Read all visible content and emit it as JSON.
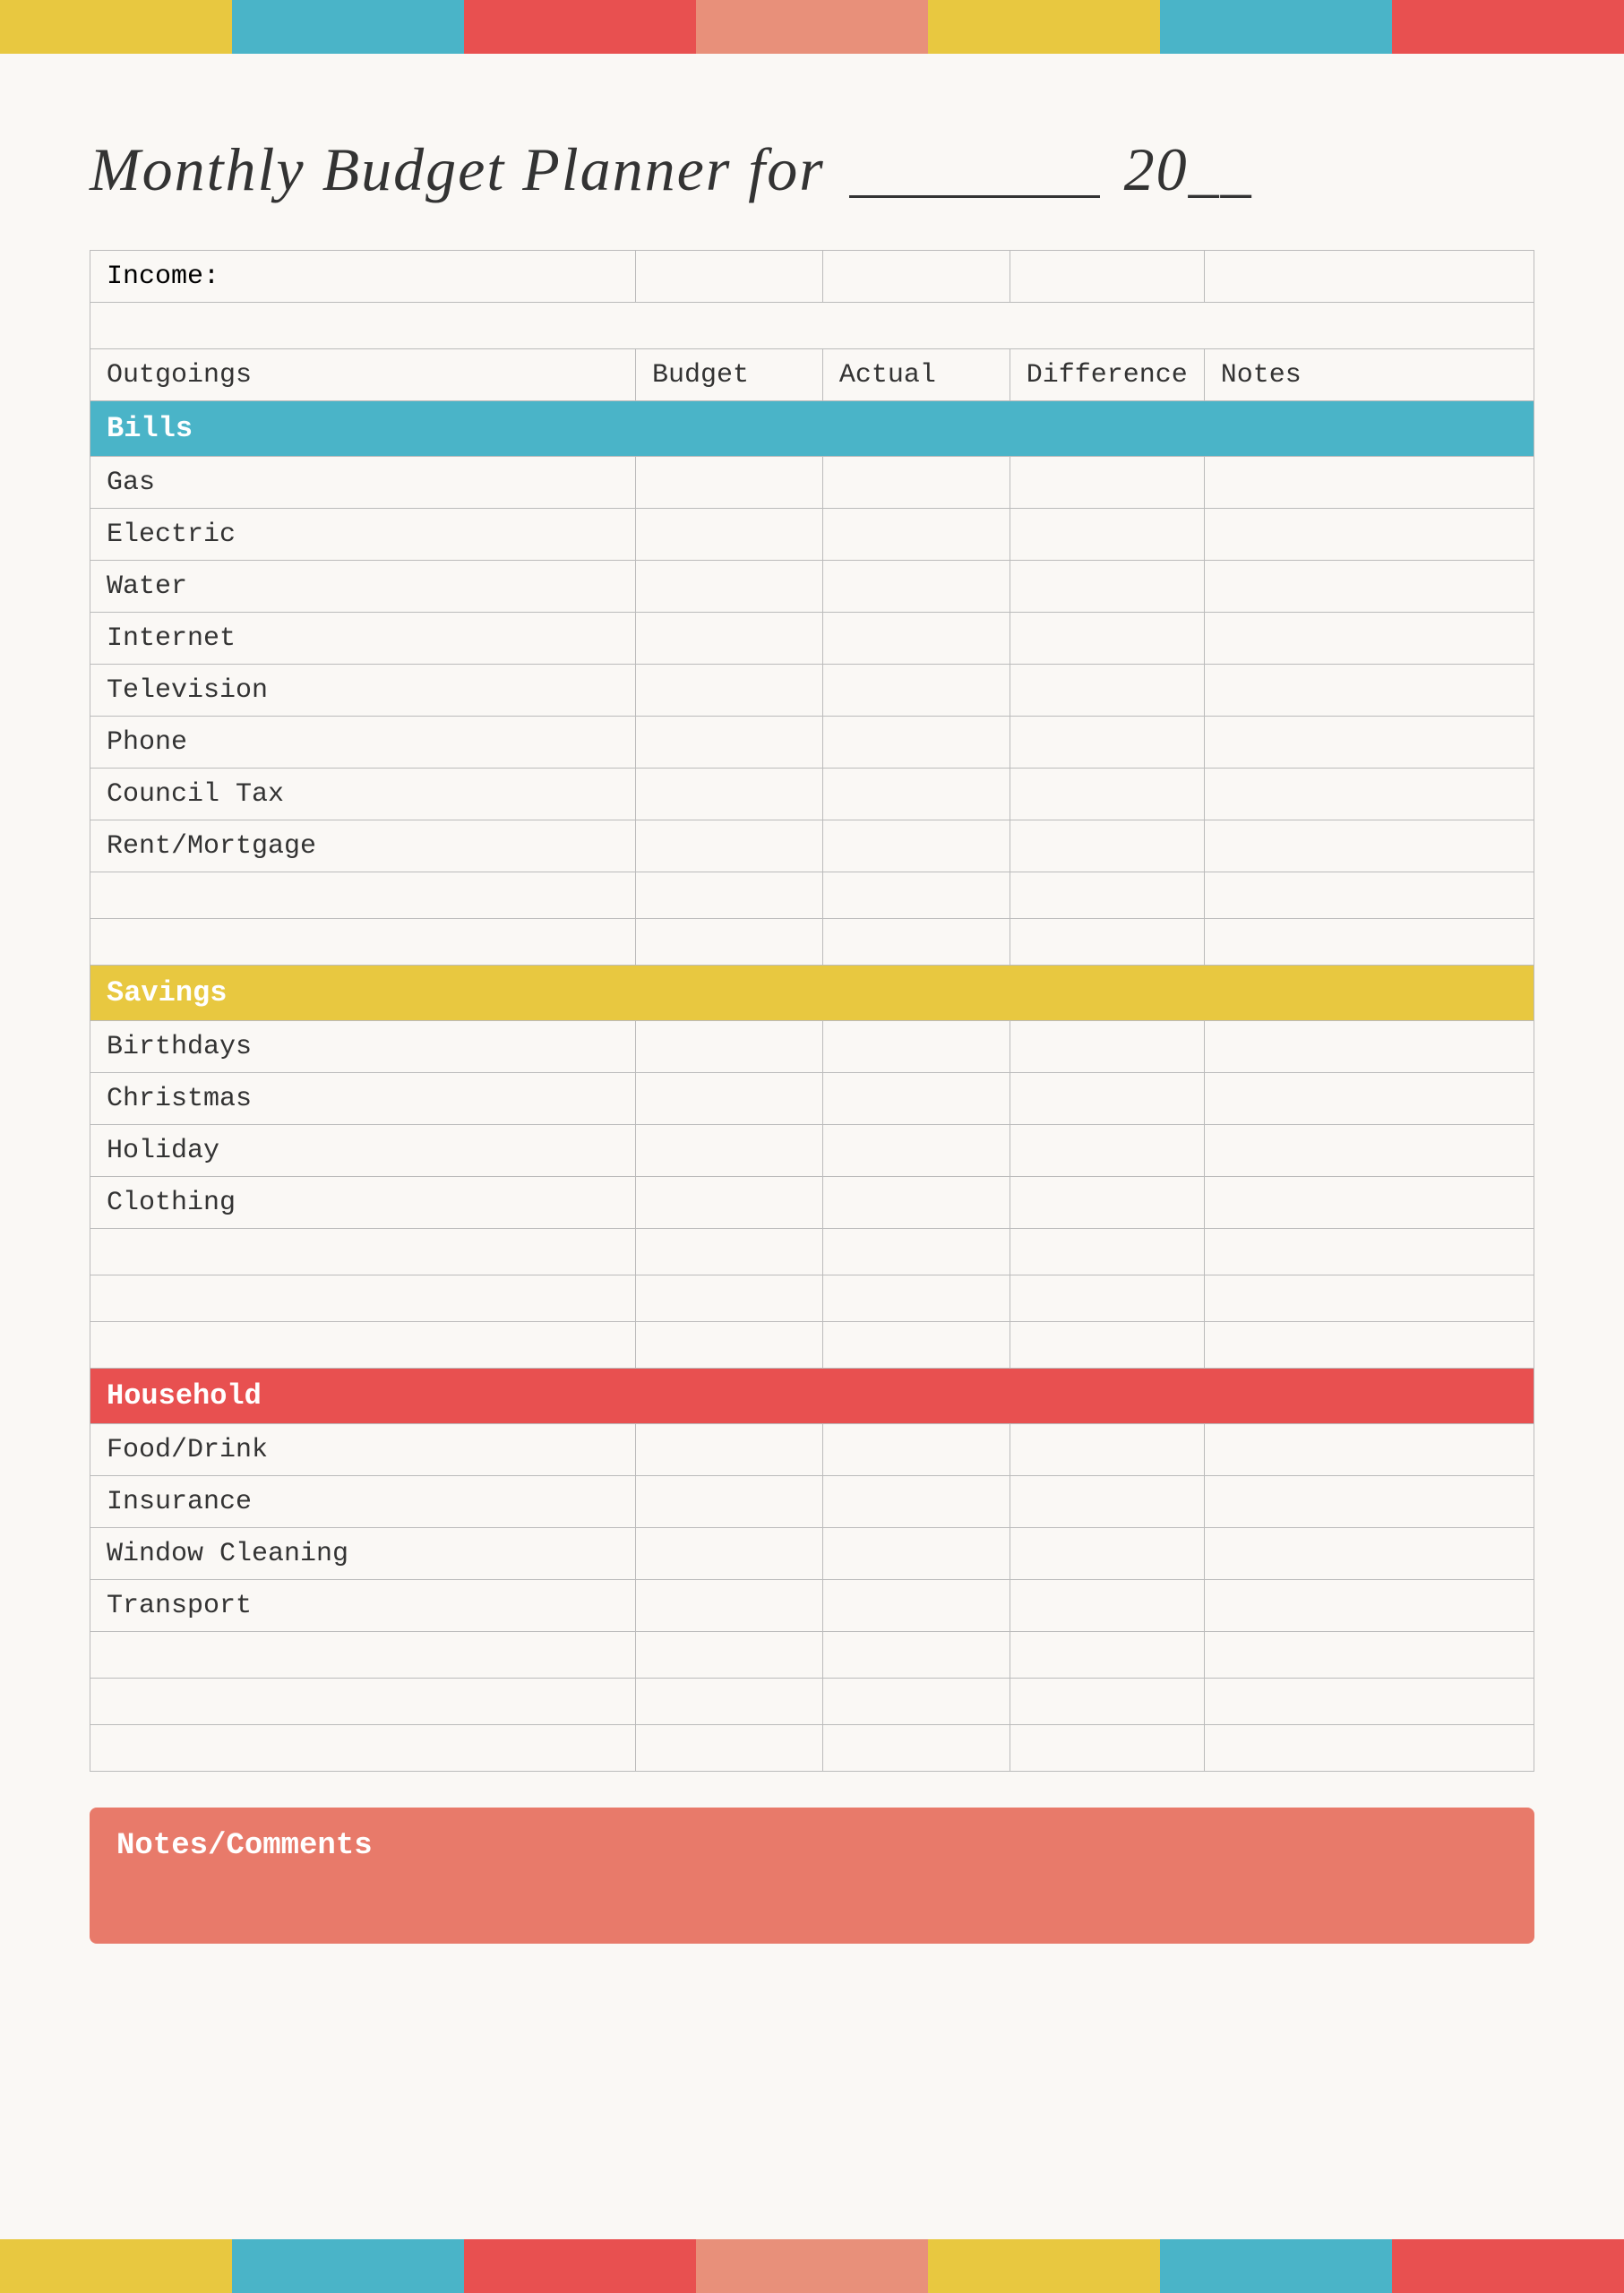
{
  "topBar": [
    {
      "color": "#e8c840",
      "name": "yellow"
    },
    {
      "color": "#4ab4c8",
      "name": "teal"
    },
    {
      "color": "#e85050",
      "name": "red"
    },
    {
      "color": "#e8907a",
      "name": "salmon"
    },
    {
      "color": "#e8c840",
      "name": "yellow2"
    },
    {
      "color": "#4ab4c8",
      "name": "teal2"
    },
    {
      "color": "#e85050",
      "name": "red2"
    }
  ],
  "bottomBar": [
    {
      "color": "#e8c840",
      "name": "yellow"
    },
    {
      "color": "#4ab4c8",
      "name": "teal"
    },
    {
      "color": "#e85050",
      "name": "red"
    },
    {
      "color": "#e8907a",
      "name": "salmon"
    },
    {
      "color": "#e8c840",
      "name": "yellow2"
    },
    {
      "color": "#4ab4c8",
      "name": "teal2"
    },
    {
      "color": "#e85050",
      "name": "red2"
    }
  ],
  "title": {
    "prefix": "Monthly Budget Planner for",
    "underline_label": "___________",
    "year_label": "20__"
  },
  "table": {
    "headers": {
      "outgoings": "Outgoings",
      "budget": "Budget",
      "actual": "Actual",
      "difference": "Difference",
      "notes": "Notes"
    },
    "income_label": "Income:",
    "sections": [
      {
        "name": "Bills",
        "color": "#4ab4c8",
        "rows": [
          "Gas",
          "Electric",
          "Water",
          "Internet",
          "Television",
          "Phone",
          "Council Tax",
          "Rent/Mortgage",
          "",
          ""
        ]
      },
      {
        "name": "Savings",
        "color": "#e8c840",
        "rows": [
          "Birthdays",
          "Christmas",
          "Holiday",
          "Clothing",
          "",
          "",
          ""
        ]
      },
      {
        "name": "Household",
        "color": "#e85050",
        "rows": [
          "Food/Drink",
          "Insurance",
          "Window Cleaning",
          "Transport",
          "",
          "",
          ""
        ]
      }
    ]
  },
  "notes": {
    "title": "Notes/Comments",
    "content": ""
  }
}
